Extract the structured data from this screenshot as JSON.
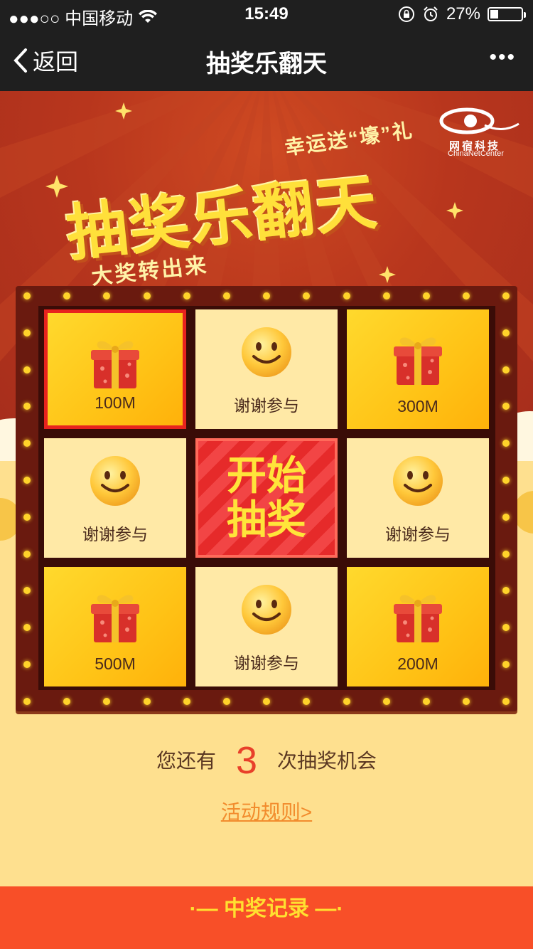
{
  "status_bar": {
    "carrier": "●●●○○ 中国移动",
    "time": "15:49",
    "battery": "27%",
    "battery_level": 0.27
  },
  "nav": {
    "back": "返回",
    "title": "抽奖乐翻天",
    "more": "•••"
  },
  "hero": {
    "subtitle_top": "幸运送“壕”礼",
    "main_title": "抽奖乐翻天",
    "subtitle_bottom": "大奖转出来",
    "logo_cn": "网宿科技",
    "logo_en": "ChinaNetCenter"
  },
  "grid": {
    "cells": [
      {
        "label": "100M",
        "icon": "gift-icon",
        "style": "gold",
        "active": true
      },
      {
        "label": "谢谢参与",
        "icon": "smiley-icon",
        "style": "light"
      },
      {
        "label": "300M",
        "icon": "gift-icon",
        "style": "gold"
      },
      {
        "label": "谢谢参与",
        "icon": "smiley-icon",
        "style": "light"
      },
      {
        "label": "谢谢参与",
        "icon": "smiley-icon",
        "style": "light"
      },
      {
        "label": "500M",
        "icon": "gift-icon",
        "style": "gold"
      },
      {
        "label": "谢谢参与",
        "icon": "smiley-icon",
        "style": "light"
      },
      {
        "label": "200M",
        "icon": "gift-icon",
        "style": "gold"
      }
    ],
    "start_line1": "开始",
    "start_line2": "抽奖"
  },
  "chance": {
    "prefix": "您还有",
    "count": "3",
    "suffix": "次抽奖机会"
  },
  "rules_link": "活动规则>",
  "footer": "·— 中奖记录 —·",
  "colors": {
    "accent_red": "#e8231e",
    "gold": "#ffc316",
    "footer": "#f84f28",
    "link": "#f28c2d"
  }
}
